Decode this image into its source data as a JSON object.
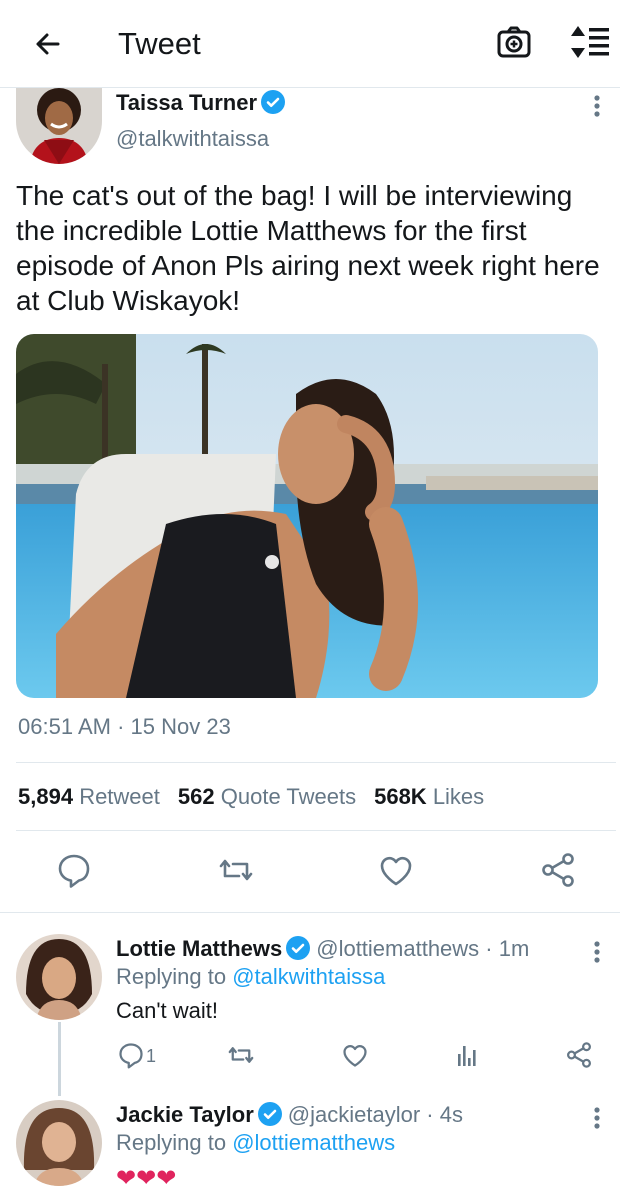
{
  "header": {
    "title": "Tweet",
    "back_icon": "arrow-left-icon",
    "camera_icon": "camera-plus-icon",
    "sort_icon": "sort-icon"
  },
  "tweet": {
    "author_name": "Taissa Turner",
    "author_handle": "@talkwithtaissa",
    "text": "The cat's out of the bag! I will be interviewing the incredible Lottie Matthews for the first episode of Anon Pls airing next week right here at Club Wiskayok!",
    "time": "06:51 AM",
    "date_sep": " · ",
    "date": "15 Nov 23",
    "stats": {
      "retweets": "5,894",
      "retweets_label": "Retweet",
      "quotes": "562",
      "quotes_label": "Quote Tweets",
      "likes": "568K",
      "likes_label": "Likes"
    }
  },
  "replies": [
    {
      "name": "Lottie Matthews",
      "handle": "@lottiematthews · 1m",
      "replying_prefix": "Replying to ",
      "replying_to": "@talkwithtaissa",
      "text": "Can't wait!",
      "reply_count": "1"
    },
    {
      "name": "Jackie Taylor",
      "handle": "@jackietaylor · 4s",
      "replying_prefix": "Replying to ",
      "replying_to": "@lottiematthews",
      "text": "❤❤❤"
    }
  ],
  "colors": {
    "accent": "#1da1f2",
    "text": "#14171a",
    "muted": "#657786",
    "divider": "#e1e8ed"
  }
}
